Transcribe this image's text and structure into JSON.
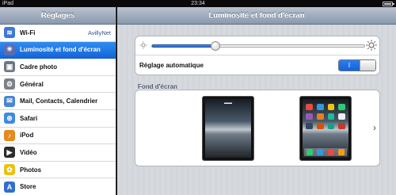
{
  "status_bar": {
    "carrier": "iPad",
    "time": "23:34"
  },
  "sidebar": {
    "title": "Réglages",
    "items": [
      {
        "label": "Wi-Fi",
        "value": "AvillyNet",
        "icon": "wifi-icon",
        "color": "#3d78d8"
      },
      {
        "label": "Luminosité et fond d'écran",
        "value": "",
        "icon": "brightness-icon",
        "color": "#5a6cb0",
        "selected": true
      },
      {
        "label": "Cadre photo",
        "value": "",
        "icon": "photo-frame-icon",
        "color": "#6e7780"
      },
      {
        "label": "Général",
        "value": "",
        "icon": "gear-icon",
        "color": "#7b8087"
      },
      {
        "label": "Mail, Contacts, Calendrier",
        "value": "",
        "icon": "mail-icon",
        "color": "#4a86d6"
      },
      {
        "label": "Safari",
        "value": "",
        "icon": "safari-icon",
        "color": "#3d8be0"
      },
      {
        "label": "iPod",
        "value": "",
        "icon": "ipod-icon",
        "color": "#e58a1c"
      },
      {
        "label": "Vidéo",
        "value": "",
        "icon": "video-icon",
        "color": "#2d2d2d"
      },
      {
        "label": "Photos",
        "value": "",
        "icon": "photos-icon",
        "color": "#e8c218"
      },
      {
        "label": "Store",
        "value": "",
        "icon": "store-icon",
        "color": "#2f6fd0"
      }
    ]
  },
  "main": {
    "title": "Luminosité et fond d'écran",
    "brightness": {
      "level": 0.3
    },
    "auto_brightness": {
      "label": "Réglage automatique",
      "state": "I"
    },
    "wallpaper": {
      "section_label": "Fond d'écran",
      "chevron": "›"
    }
  },
  "colors": {
    "selected": "#1f72e6",
    "navbar": "#a3b0c1",
    "switch_on": "#2173e8"
  }
}
